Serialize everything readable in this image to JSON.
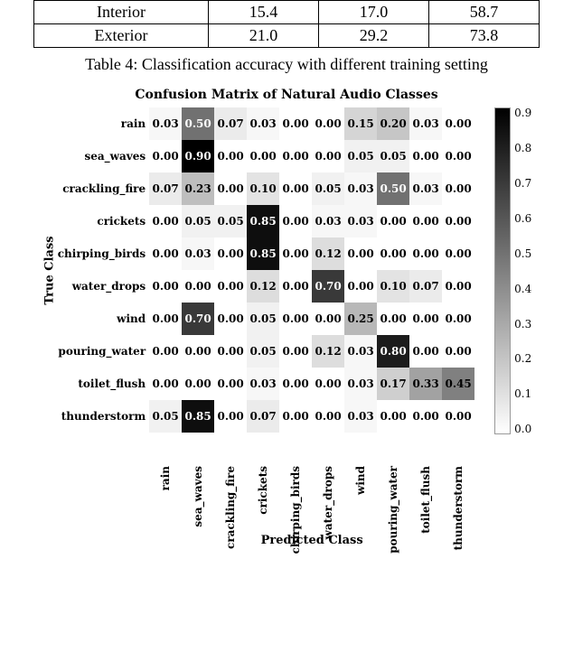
{
  "table": {
    "rows": [
      {
        "label": "Interior",
        "c1": "15.4",
        "c2": "17.0",
        "c3": "58.7"
      },
      {
        "label": "Exterior",
        "c1": "21.0",
        "c2": "29.2",
        "c3": "73.8"
      }
    ],
    "caption": "Table 4: Classification accuracy with different training setting"
  },
  "chart_data": {
    "type": "heatmap",
    "title": "Confusion Matrix of Natural Audio Classes",
    "xlabel": "Predicted Class",
    "ylabel": "True Class",
    "categories": [
      "rain",
      "sea_waves",
      "crackling_fire",
      "crickets",
      "chirping_birds",
      "water_drops",
      "wind",
      "pouring_water",
      "toilet_flush",
      "thunderstorm"
    ],
    "values": [
      [
        0.03,
        0.5,
        0.07,
        0.03,
        0.0,
        0.0,
        0.15,
        0.2,
        0.03,
        0.0
      ],
      [
        0.0,
        0.9,
        0.0,
        0.0,
        0.0,
        0.0,
        0.05,
        0.05,
        0.0,
        0.0
      ],
      [
        0.07,
        0.23,
        0.0,
        0.1,
        0.0,
        0.05,
        0.03,
        0.5,
        0.03,
        0.0
      ],
      [
        0.0,
        0.05,
        0.05,
        0.85,
        0.0,
        0.03,
        0.03,
        0.0,
        0.0,
        0.0
      ],
      [
        0.0,
        0.03,
        0.0,
        0.85,
        0.0,
        0.12,
        0.0,
        0.0,
        0.0,
        0.0
      ],
      [
        0.0,
        0.0,
        0.0,
        0.12,
        0.0,
        0.7,
        0.0,
        0.1,
        0.07,
        0.0
      ],
      [
        0.0,
        0.7,
        0.0,
        0.05,
        0.0,
        0.0,
        0.25,
        0.0,
        0.0,
        0.0
      ],
      [
        0.0,
        0.0,
        0.0,
        0.05,
        0.0,
        0.12,
        0.03,
        0.8,
        0.0,
        0.0
      ],
      [
        0.0,
        0.0,
        0.0,
        0.03,
        0.0,
        0.0,
        0.03,
        0.17,
        0.33,
        0.45
      ],
      [
        0.05,
        0.85,
        0.0,
        0.07,
        0.0,
        0.0,
        0.03,
        0.0,
        0.0,
        0.0
      ]
    ],
    "colorbar_ticks": [
      "0.9",
      "0.8",
      "0.7",
      "0.6",
      "0.5",
      "0.4",
      "0.3",
      "0.2",
      "0.1",
      "0.0"
    ],
    "vmin": 0.0,
    "vmax": 0.9
  }
}
